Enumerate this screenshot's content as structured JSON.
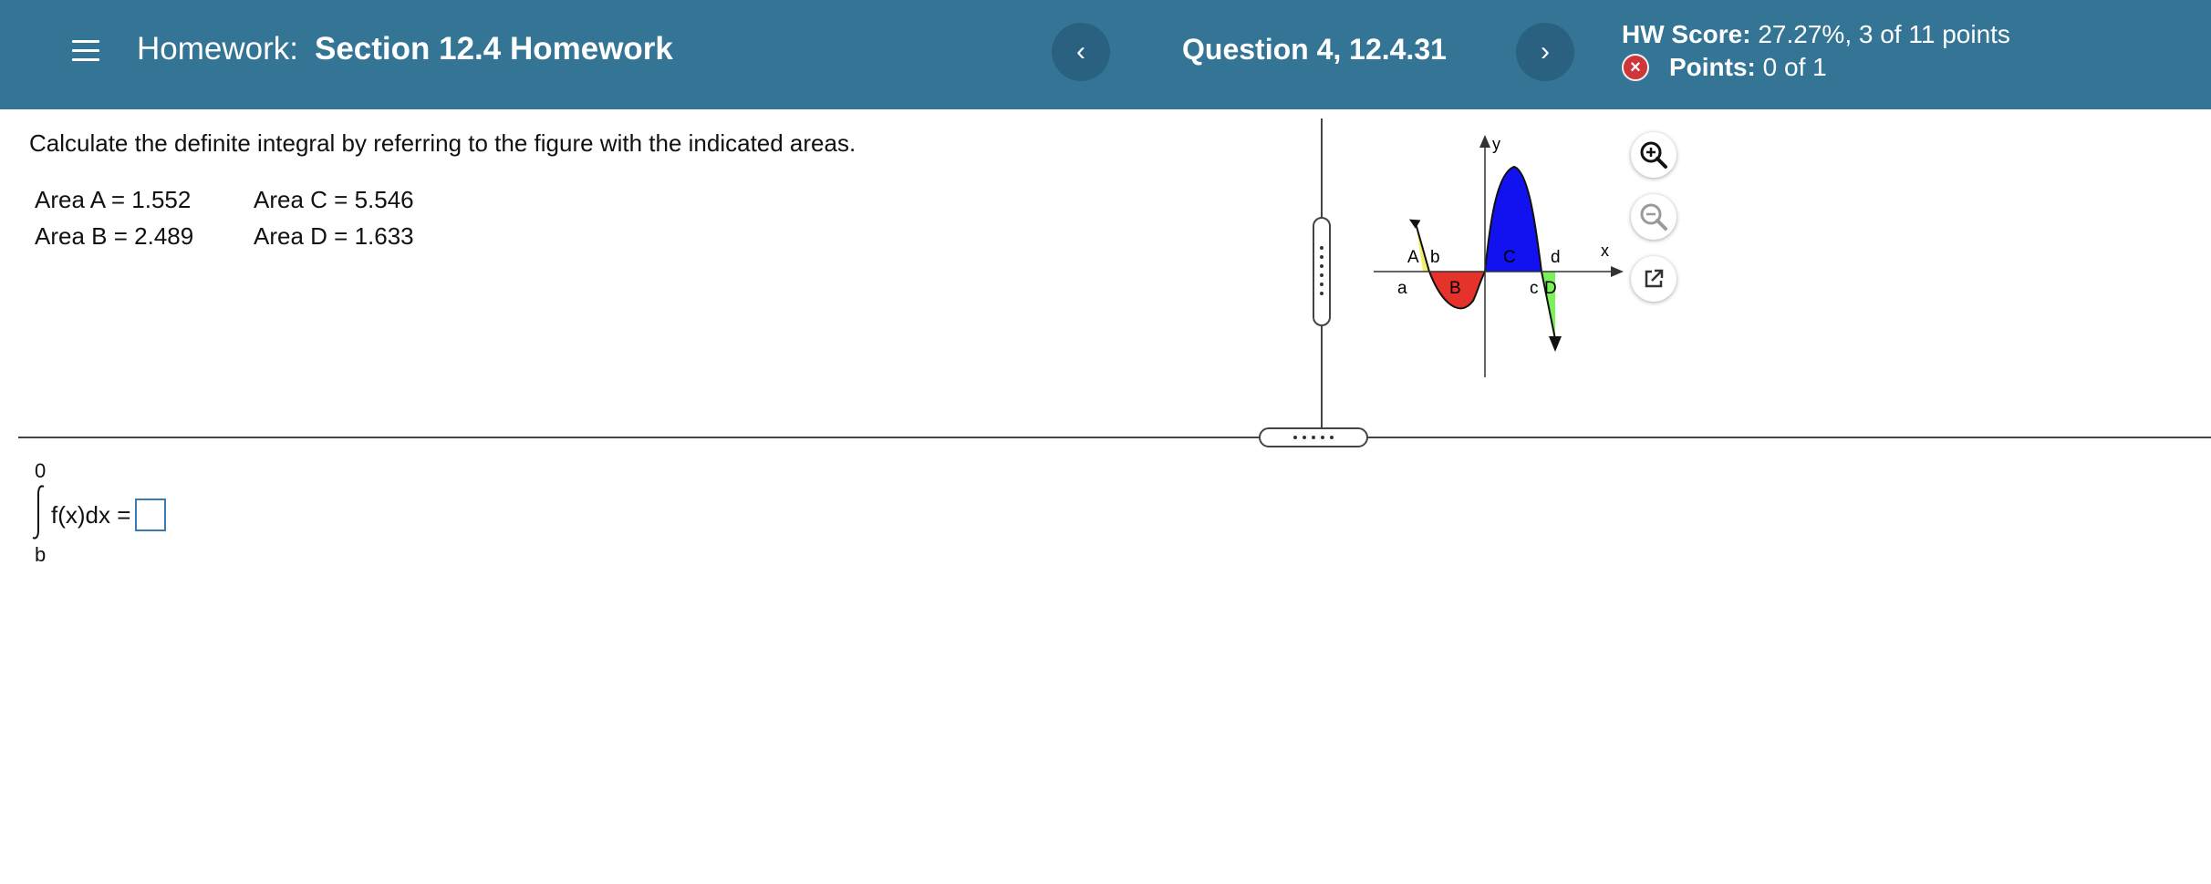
{
  "header": {
    "title_prefix": "Homework:",
    "title": "Section 12.4 Homework",
    "prev_label": "‹",
    "next_label": "›",
    "question_label": "Question 4, 12.4.31",
    "score_label": "HW Score:",
    "score_value": "27.27%, 3 of 11 points",
    "points_label": "Points:",
    "points_value": "0 of 1",
    "points_status_icon": "x-circle-icon",
    "colors": {
      "bar": "#347596",
      "status_incorrect": "#d0353a"
    }
  },
  "question": {
    "instructions": "Calculate the definite integral by referring to the figure with the indicated areas.",
    "areas": [
      {
        "label": "Area A",
        "value": "1.552"
      },
      {
        "label": "Area B",
        "value": "2.489"
      },
      {
        "label": "Area C",
        "value": "5.546"
      },
      {
        "label": "Area D",
        "value": "1.633"
      }
    ]
  },
  "figure": {
    "labels": {
      "y": "y",
      "x": "x",
      "a": "a",
      "b": "b",
      "c": "c",
      "d": "d",
      "A": "A",
      "B": "B",
      "C": "C",
      "D": "D"
    },
    "region_colors": {
      "A": "#f3ef6a",
      "B": "#e5322b",
      "C": "#1212f0",
      "D": "#7cf05a"
    },
    "tools": [
      "zoom-in-icon",
      "zoom-out-icon",
      "open-external-icon"
    ]
  },
  "answer": {
    "upper_limit": "0",
    "lower_limit": "b",
    "integrand": "f(x)dx =",
    "input_value": ""
  }
}
